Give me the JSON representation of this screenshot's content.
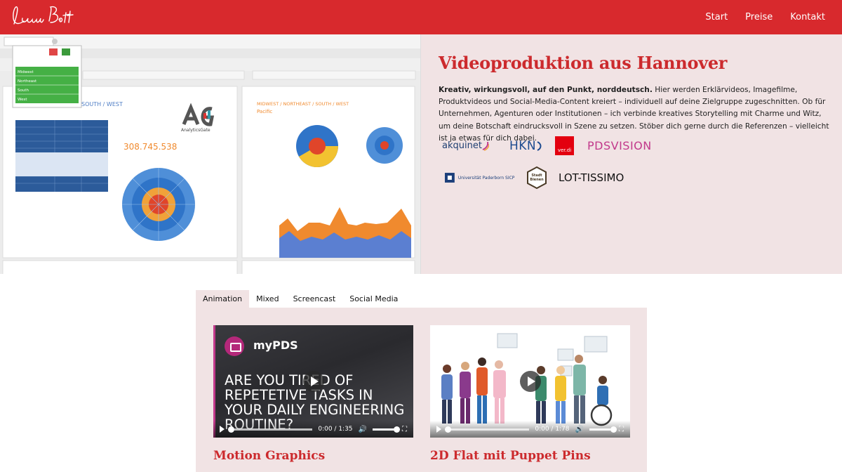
{
  "header": {
    "logo_text": "Laura Bott",
    "nav": [
      {
        "label": "Start"
      },
      {
        "label": "Preise"
      },
      {
        "label": "Kontakt"
      }
    ]
  },
  "hero": {
    "title": "Videoproduktion aus Hannover",
    "lead": "Kreativ, wirkungsvoll, auf den Punkt, norddeutsch.",
    "body": " Hier werden Erklärvideos, Imagefilme, Produktvideos und Social-Media-Content kreiert – individuell auf deine Zielgruppe zugeschnitten. Ob für Unternehmen, Agenturen oder Institutionen – ich verbinde kreatives Storytelling mit Charme und Witz, um deine Botschaft eindrucksvoll in Szene zu setzen. Stöber dich gerne durch die Referenzen – vielleicht ist ja etwas für dich dabei.",
    "screenshot": {
      "filter_items": [
        "Midwest",
        "Northeast",
        "South",
        "West"
      ],
      "big_number": "308.745.538",
      "panel_heading_left": "SOUTH / WEST",
      "panel_heading_right": "MIDWEST / NORTHEAST / SOUTH / WEST",
      "panel_sub_right": "Pacific",
      "brand": "AnalyticsGate"
    },
    "clients": [
      {
        "name": "akquinet"
      },
      {
        "name": "HKN"
      },
      {
        "name": "ver.di"
      },
      {
        "name": "PDSVISION"
      },
      {
        "name": "Universität Paderborn SICP"
      },
      {
        "name": "Stadt Bienen"
      },
      {
        "name": "LOT-TISSIMO"
      }
    ]
  },
  "tabs": [
    {
      "label": "Animation"
    },
    {
      "label": "Mixed"
    },
    {
      "label": "Screencast"
    },
    {
      "label": "Social Media"
    }
  ],
  "videos": [
    {
      "title": "Motion Graphics",
      "brand": "myPDS",
      "headline": "ARE YOU TIRED OF REPETETIVE TASKS IN YOUR DAILY ENGINEERING ROUTINE?",
      "time": "0:00 / 1:35"
    },
    {
      "title": "2D Flat mit Puppet Pins",
      "time": "0:00 / 1:78"
    }
  ],
  "colors": {
    "brand_red": "#d8292d",
    "heading_red": "#cc2a2d",
    "panel_pink": "#f1e3e4"
  }
}
